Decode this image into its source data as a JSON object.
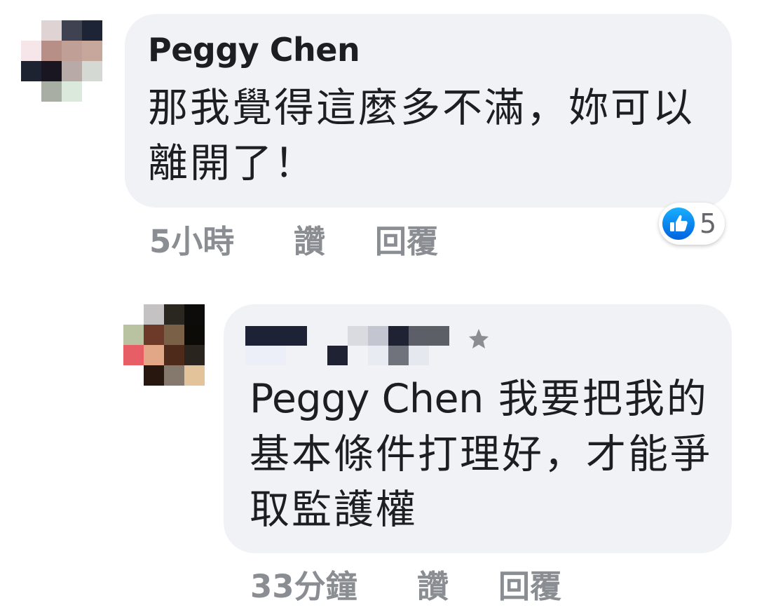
{
  "comments": [
    {
      "author": "Peggy Chen",
      "text": "那我覺得這麼多不滿，妳可以離開了！",
      "timestamp": "5小時",
      "like_label": "讚",
      "reply_label": "回覆",
      "reaction": {
        "icon": "thumbs-up-icon",
        "count": "5",
        "color": "#1877f2"
      },
      "avatar_colors": [
        "#ffffff",
        "#e0d3d3",
        "#3f4250",
        "#1d2436",
        "#f6e6e9",
        "#b88f86",
        "#c09f96",
        "#c7a79c",
        "#1d2330",
        "#191622",
        "#b8aaa6",
        "#d5d9d3",
        "#ffffff",
        "#a8aea3",
        "#dbe8dc",
        "#ffffff"
      ]
    },
    {
      "author_redacted": true,
      "mention": "Peggy Chen",
      "text": " 我要把我的基本條件打理好，才能爭取監護權",
      "timestamp": "33分鐘",
      "like_label": "讚",
      "reply_label": "回覆",
      "badge_icon": "star-icon",
      "avatar_colors": [
        "#ffffff",
        "#c4c2c2",
        "#2a2620",
        "#0e0c0a",
        "#b9c3a1",
        "#6d3a2a",
        "#7b6048",
        "#0d0b08",
        "#e85e66",
        "#e2a786",
        "#4d2a1a",
        "#2a241e",
        "#ffffff",
        "#27170f",
        "#85786d",
        "#e3c399"
      ]
    }
  ]
}
